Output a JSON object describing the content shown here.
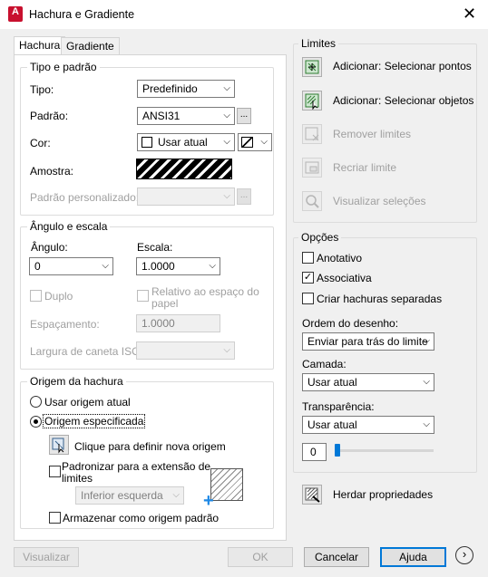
{
  "window": {
    "title": "Hachura e Gradiente",
    "app_icon_letter": "A"
  },
  "tabs": [
    {
      "label": "Hachura"
    },
    {
      "label": "Gradiente"
    }
  ],
  "tipo_padrao": {
    "title": "Tipo e padrão",
    "tipo_label": "Tipo:",
    "tipo_value": "Predefinido",
    "padrao_label": "Padrão:",
    "padrao_value": "ANSI31",
    "padrao_browse": "...",
    "cor_label": "Cor:",
    "cor_value": "Usar atual",
    "amostra_label": "Amostra:",
    "personalizado_label": "Padrão personalizado:",
    "personalizado_browse": "..."
  },
  "angulo_escala": {
    "title": "Ângulo e escala",
    "angulo_label": "Ângulo:",
    "angulo_value": "0",
    "escala_label": "Escala:",
    "escala_value": "1.0000",
    "duplo_label": "Duplo",
    "relativo_label_1": "Relativo ao espaço do",
    "relativo_label_2": "papel",
    "espacamento_label": "Espaçamento:",
    "espacamento_value": "1.0000",
    "largura_label": "Largura de caneta ISO:"
  },
  "origem": {
    "title": "Origem da hachura",
    "usar_atual_label": "Usar origem atual",
    "especificada_label": "Origem especificada",
    "clique_label": "Clique para definir nova origem",
    "padronizar_label_1": "Padronizar para a extensão de",
    "padronizar_label_2": "limites",
    "posicao_value": "Inferior esquerda",
    "armazenar_label": "Armazenar como origem padrão"
  },
  "limites": {
    "title": "Limites",
    "selecionar_pontos": "Adicionar: Selecionar pontos",
    "selecionar_objetos": "Adicionar: Selecionar objetos",
    "remover": "Remover limites",
    "recriar": "Recriar limite",
    "visualizar": "Visualizar seleções"
  },
  "opcoes": {
    "title": "Opções",
    "anotativo": "Anotativo",
    "associativa": "Associativa",
    "separadas": "Criar hachuras separadas",
    "ordem_label": "Ordem do desenho:",
    "ordem_value": "Enviar para trás do limite",
    "camada_label": "Camada:",
    "camada_value": "Usar atual",
    "transparencia_label": "Transparência:",
    "transparencia_value": "Usar atual",
    "transparencia_amount": "0"
  },
  "herdar": "Herdar propriedades",
  "footer": {
    "visualizar": "Visualizar",
    "ok": "OK",
    "cancelar": "Cancelar",
    "ajuda": "Ajuda"
  }
}
